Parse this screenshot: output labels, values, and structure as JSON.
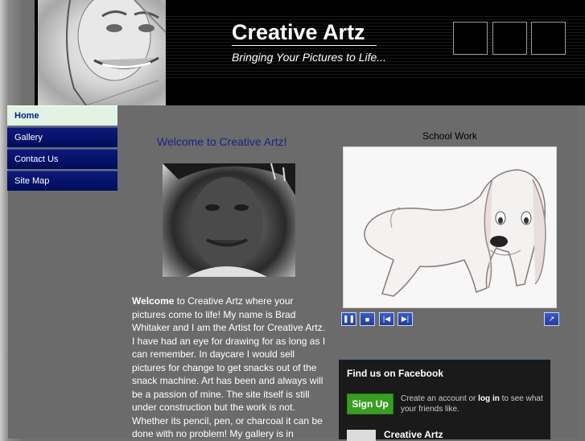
{
  "header": {
    "title": "Creative Artz",
    "tagline": "Bringing Your Pictures to Life..."
  },
  "nav": {
    "items": [
      {
        "label": "Home",
        "active": true
      },
      {
        "label": "Gallery",
        "active": false
      },
      {
        "label": "Contact Us",
        "active": false
      },
      {
        "label": "Site Map",
        "active": false
      }
    ]
  },
  "main": {
    "heading": "Welcome to Creative Artz!",
    "intro_bold": "Welcome",
    "intro_text": " to Creative Artz where your pictures come to life! My name is Brad Whitaker and I am the Artist for Creative Artz. I have had an eye for drawing for as long as I can remember. In daycare I would sell pictures for change to get snacks out of the snack machine. Art has been and always will be a passion of mine. The site itself is still under construction but the work is not. Whether its pencil, pen, or charcoal it can be done with no problem! My gallery is in"
  },
  "slideshow": {
    "caption": "School Work",
    "controls": {
      "pause_icon": "pause-icon",
      "stop_icon": "stop-icon",
      "prev_icon": "previous-icon",
      "next_icon": "next-icon",
      "popout_icon": "popout-icon"
    }
  },
  "facebook": {
    "title": "Find us on Facebook",
    "signup_label": "Sign Up",
    "text_before": "Create an account or ",
    "login_label": "log in",
    "text_after": " to see what your friends like.",
    "page_name": "Creative Artz"
  },
  "colors": {
    "nav_bg": "#0d1a7a",
    "nav_active_bg": "#e2f3e4",
    "heading": "#1b1f8a",
    "fb_signup": "#3a9d23",
    "fb_border": "#4e69a2"
  }
}
